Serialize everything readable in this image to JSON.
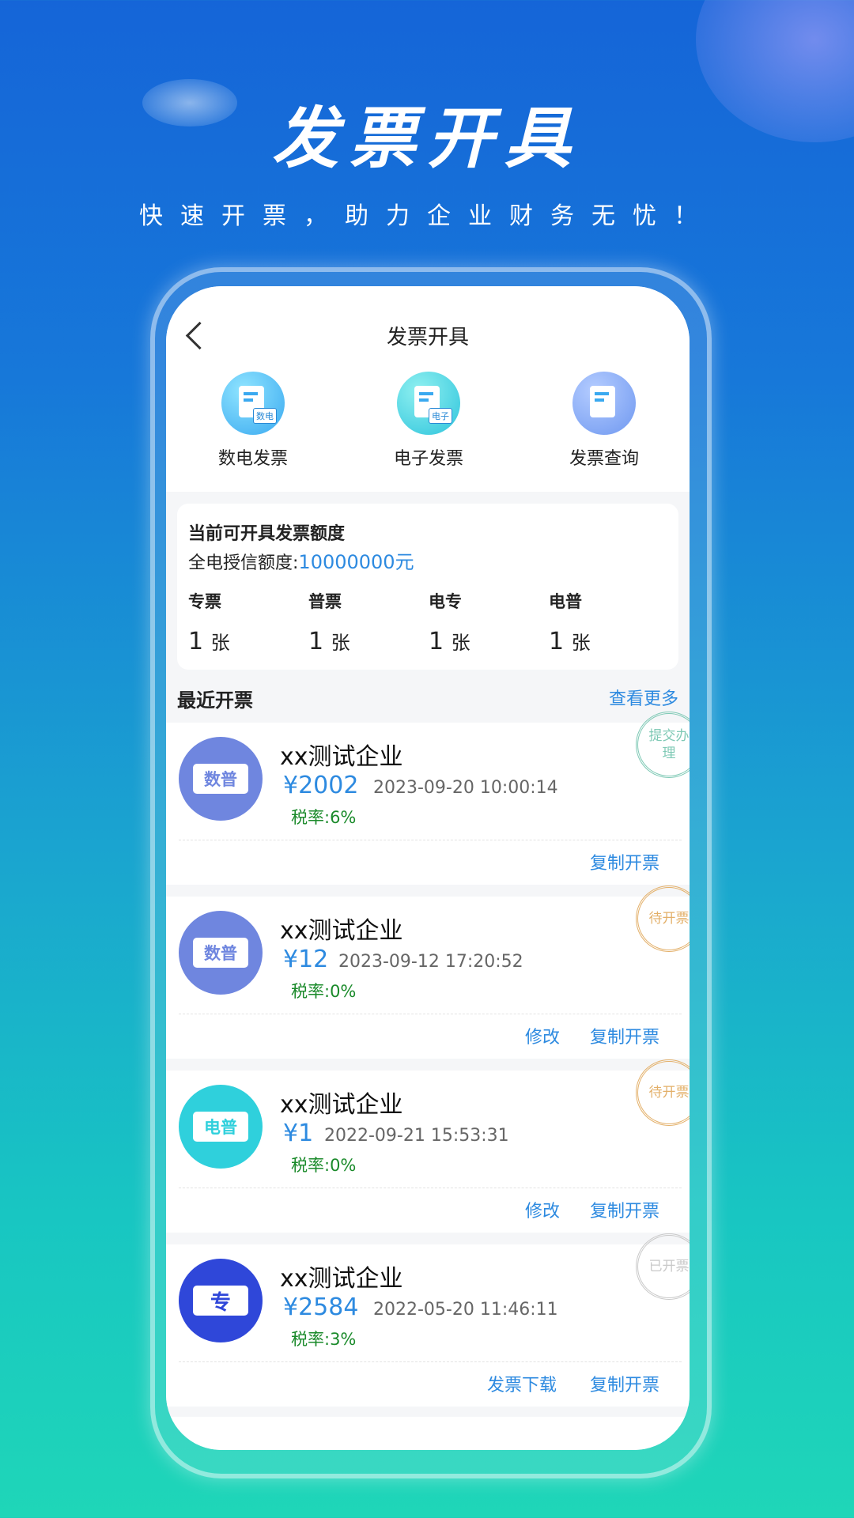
{
  "hero": {
    "title": "发票开具",
    "subtitle": "快速开票，助力企业财务无忧！"
  },
  "app": {
    "nav_title": "发票开具",
    "shortcuts": [
      {
        "label": "数电发票",
        "icon": "invoice-digital-icon",
        "tag": "数电"
      },
      {
        "label": "电子发票",
        "icon": "invoice-electronic-icon",
        "tag": "电子"
      },
      {
        "label": "发票查询",
        "icon": "invoice-search-icon",
        "tag": ""
      }
    ],
    "quota": {
      "title": "当前可开具发票额度",
      "credit_label": "全电授信额度:",
      "credit_value": "10000000元",
      "types": [
        {
          "name": "专票",
          "count": "1",
          "unit": "张"
        },
        {
          "name": "普票",
          "count": "1",
          "unit": "张"
        },
        {
          "name": "电专",
          "count": "1",
          "unit": "张"
        },
        {
          "name": "电普",
          "count": "1",
          "unit": "张"
        }
      ]
    },
    "recent": {
      "title": "最近开票",
      "more": "查看更多",
      "invoices": [
        {
          "badge": "数普",
          "badge_color": "#6f86df",
          "company": "xx测试企业",
          "amount": "¥2002",
          "date": "2023-09-20 10:00:14",
          "tax": "税率:6%",
          "status": "提交办理",
          "status_color": "#7fc9b5",
          "actions": [
            "复制开票"
          ]
        },
        {
          "badge": "数普",
          "badge_color": "#6f86df",
          "company": "xx测试企业",
          "amount": "¥12",
          "date": "2023-09-12 17:20:52",
          "tax": "税率:0%",
          "status": "待开票",
          "status_color": "#e3b06a",
          "actions": [
            "修改",
            "复制开票"
          ]
        },
        {
          "badge": "电普",
          "badge_color": "#2fd0dc",
          "company": "xx测试企业",
          "amount": "¥1",
          "date": "2022-09-21 15:53:31",
          "tax": "税率:0%",
          "status": "待开票",
          "status_color": "#e3b06a",
          "actions": [
            "修改",
            "复制开票"
          ]
        },
        {
          "badge": "专",
          "badge_color": "#2f47d9",
          "company": "xx测试企业",
          "amount": "¥2584",
          "date": "2022-05-20 11:46:11",
          "tax": "税率:3%",
          "status": "已开票",
          "status_color": "#c9c9c9",
          "actions": [
            "发票下载",
            "复制开票"
          ]
        }
      ]
    }
  }
}
